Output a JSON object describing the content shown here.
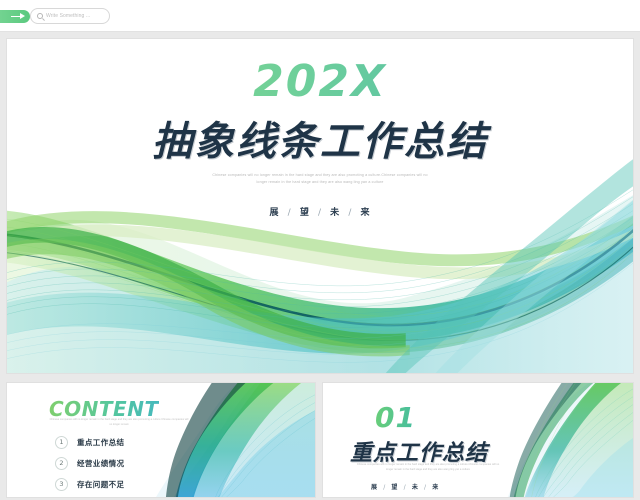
{
  "toolbar": {
    "back_button_label": "",
    "search_placeholder": "Write Something ...",
    "search_value": "",
    "search_icon": "search-icon",
    "back_icon": "arrow-right-icon"
  },
  "main_slide": {
    "year": "202X",
    "title": "抽象线条工作总结",
    "paragraph": "Chinese companies  will no longer remain in the hard stage and they are also promoting a culture.Chinese companies will no longer remain in the hard stage and they are also wang ling yan a culture",
    "motto": [
      "展",
      "望",
      "未",
      "来"
    ],
    "motto_separator": "/"
  },
  "content_slide": {
    "heading": "CONTENT",
    "subtitle": "Chinese companies will no longer remain in the hard stage and they are also promoting a culture Chinese companies will no longer remain",
    "items": [
      {
        "number": "1",
        "label": "重点工作总结"
      },
      {
        "number": "2",
        "label": "经营业绩情况"
      },
      {
        "number": "3",
        "label": "存在问题不足"
      }
    ]
  },
  "section_slide": {
    "number": "01",
    "title": "重点工作总结",
    "paragraph": "Chinese companies will no longer remain in the hard stage and they are also promoting a culture.Chinese companies will no longer remain in the hard stage and they are also wang ling yan a culture",
    "motto": [
      "展",
      "望",
      "未",
      "来"
    ],
    "motto_separator": "/"
  },
  "colors": {
    "accent_green": "#5bc97f",
    "accent_teal": "#43b3b0",
    "title_navy": "#1f3447",
    "page_background": "#e9e9e9",
    "slide_background": "#ffffff"
  }
}
